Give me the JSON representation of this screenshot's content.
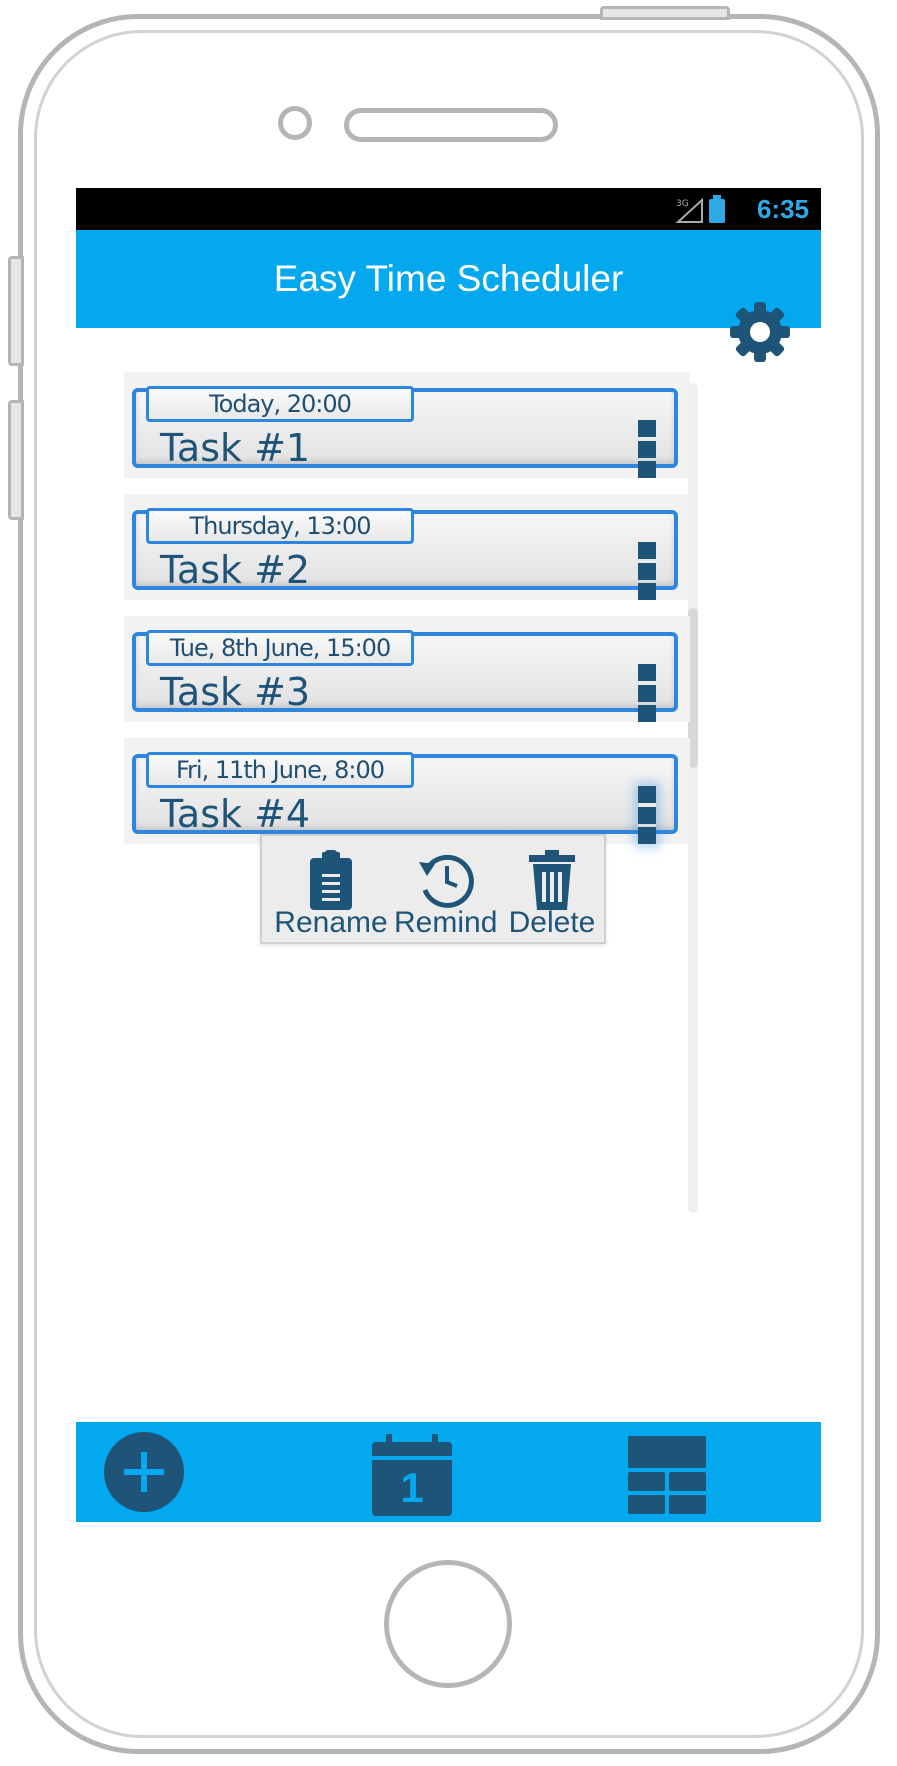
{
  "status_bar": {
    "time": "6:35",
    "signal_icon": "signal-3g-icon",
    "battery_icon": "battery-icon"
  },
  "header": {
    "title": "Easy Time Scheduler"
  },
  "settings": {
    "icon": "gear-icon"
  },
  "tasks": [
    {
      "date": "Today, 20:00",
      "title": "Task #1"
    },
    {
      "date": "Thursday, 13:00",
      "title": "Task #2"
    },
    {
      "date": "Tue, 8th June, 15:00",
      "title": "Task #3"
    },
    {
      "date": "Fri, 11th June, 8:00",
      "title": "Task #4"
    }
  ],
  "context_menu": {
    "rename_label": "Rename",
    "remind_label": "Remind",
    "delete_label": "Delete"
  },
  "bottom_bar": {
    "add_icon": "plus-icon",
    "calendar_icon": "calendar-icon",
    "calendar_day": "1",
    "grid_icon": "grid-view-icon"
  },
  "colors": {
    "accent": "#04a8ef",
    "dark_blue": "#1f5479",
    "card_border": "#2e86de"
  }
}
